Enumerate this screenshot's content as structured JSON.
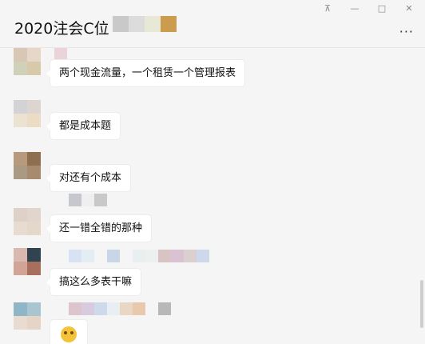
{
  "window": {
    "title": "2020注会C位",
    "controls": {
      "pin": "⊼",
      "minimize": "—",
      "maximize": "□",
      "close": "✕"
    },
    "more_icon": "···"
  },
  "messages": [
    {
      "type": "text",
      "text": "两个现金流量，一个租赁一个管理报表"
    },
    {
      "type": "text",
      "text": "都是成本题"
    },
    {
      "type": "text",
      "text": "对还有个成本"
    },
    {
      "type": "text",
      "text": "还一错全错的那种"
    },
    {
      "type": "text",
      "text": "搞这么多表干嘛"
    },
    {
      "type": "emoji",
      "icon": "crying-face-emoji"
    }
  ],
  "colors": {
    "background": "#f5f5f5",
    "bubble": "#ffffff",
    "text": "#111111"
  }
}
